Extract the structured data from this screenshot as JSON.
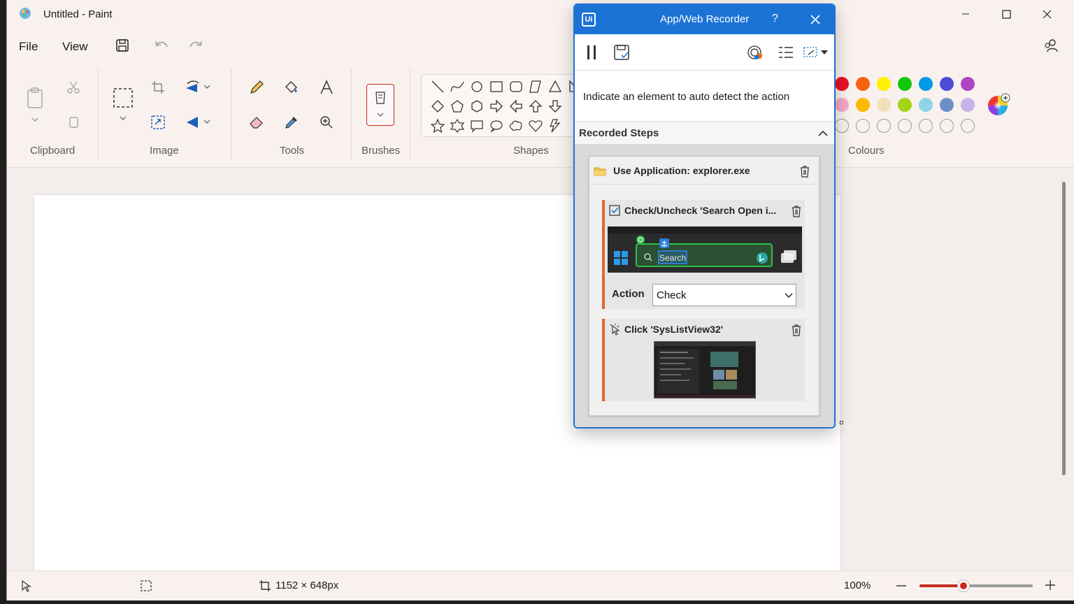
{
  "window": {
    "title": "Untitled - Paint"
  },
  "menu": {
    "file": "File",
    "view": "View"
  },
  "ribbon": {
    "groups": {
      "clipboard": "Clipboard",
      "image": "Image",
      "tools": "Tools",
      "brushes": "Brushes",
      "shapes": "Shapes",
      "colours": "Colours"
    },
    "colours_row1": [
      "#e81123",
      "#f7630c",
      "#fff100",
      "#16c60c",
      "#0099e5",
      "#4f4bd9",
      "#b146c2"
    ],
    "colours_row2": [
      "#f4a7c6",
      "#fcb900",
      "#f1e0b8",
      "#a4d416",
      "#8fd3e8",
      "#6d8fc9",
      "#c6b2e6"
    ]
  },
  "status": {
    "canvas_size": "1152 × 648px",
    "zoom": "100%",
    "zoom_level": 0.39
  },
  "recorder": {
    "title": "App/Web Recorder",
    "help": "?",
    "logo": "Ui",
    "indicate_text": "Indicate an element to auto detect the action",
    "recorded_steps_label": "Recorded Steps",
    "app_scope": "Use Application: explorer.exe",
    "steps": [
      {
        "title": "Check/Uncheck 'Search Open i...",
        "thumbnail_text": "Search",
        "action_label": "Action",
        "action_value": "Check"
      },
      {
        "title": "Click 'SysListView32'"
      }
    ]
  }
}
